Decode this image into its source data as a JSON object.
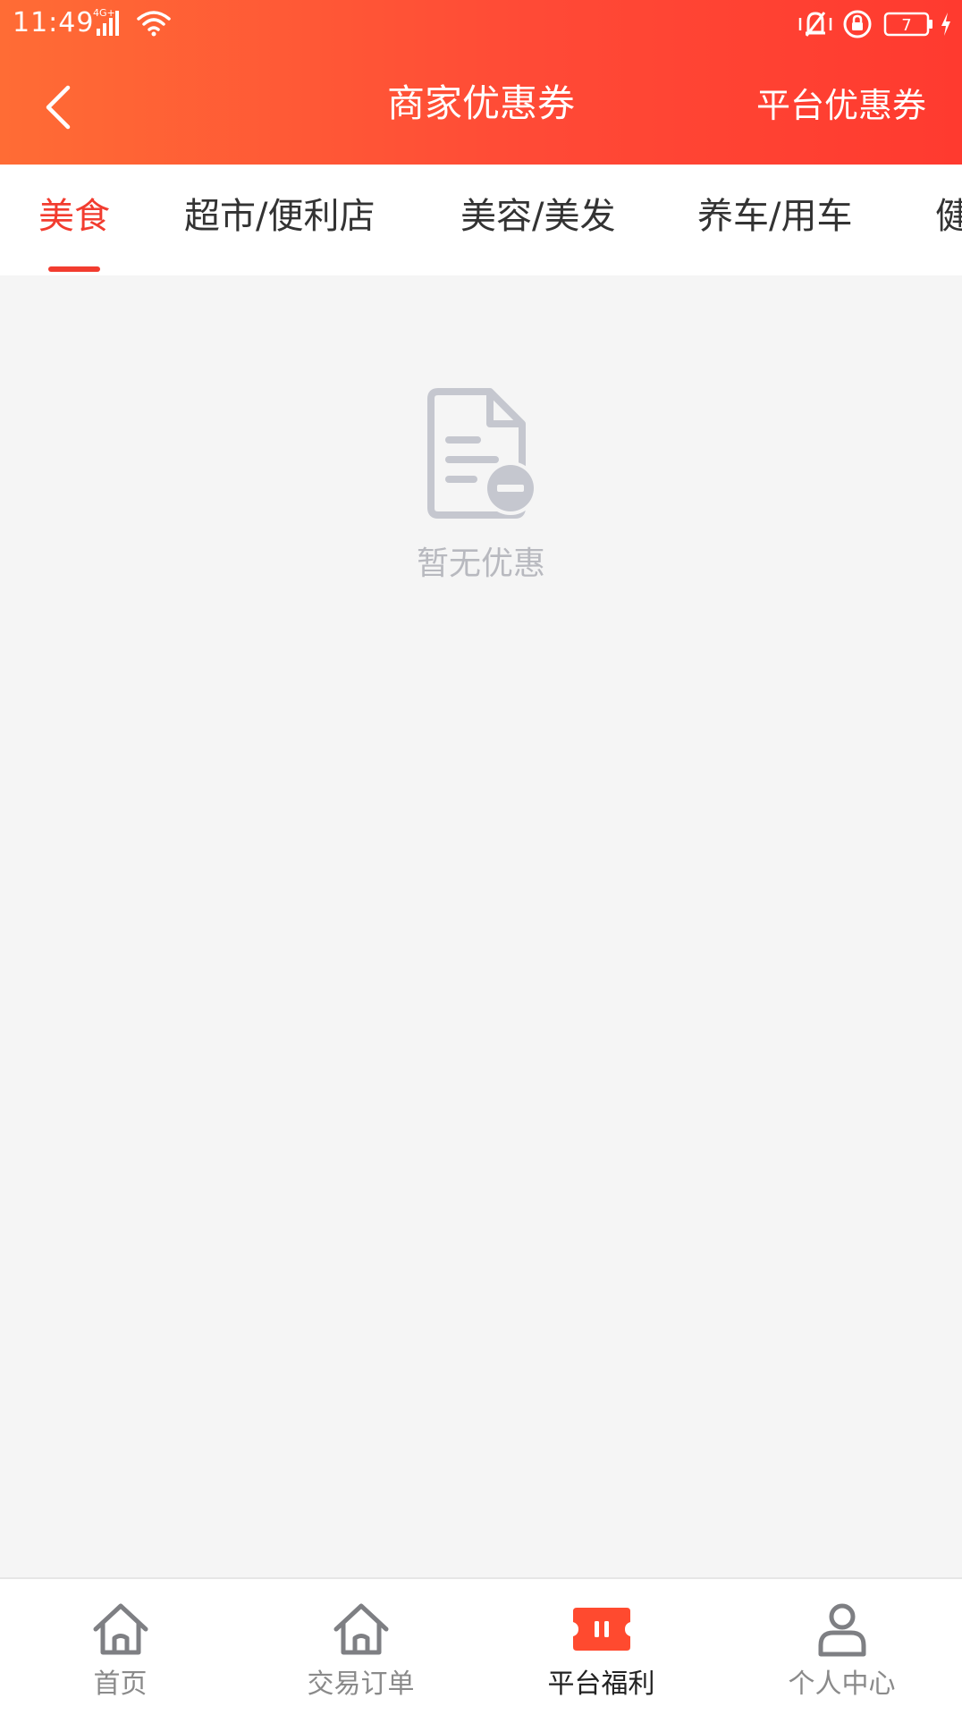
{
  "status_bar": {
    "time": "11:49",
    "network": "4G+",
    "battery": "7",
    "icons": [
      "signal-icon",
      "wifi-icon",
      "vibrate-icon",
      "rotation-lock-icon",
      "battery-icon",
      "charging-icon"
    ]
  },
  "header": {
    "back_icon": "chevron-left-icon",
    "title": "商家优惠券",
    "right_action": "平台优惠券",
    "gradient": [
      "#ff6c35",
      "#ff3a2f"
    ]
  },
  "tabs": {
    "active_index": 0,
    "items": [
      {
        "label": "美食"
      },
      {
        "label": "超市/便利店"
      },
      {
        "label": "美容/美发"
      },
      {
        "label": "养车/用车"
      },
      {
        "label": "健"
      }
    ],
    "active_color": "#f23c2f"
  },
  "empty_state": {
    "icon": "document-minus-icon",
    "text": "暂无优惠"
  },
  "bottom_nav": {
    "active_index": 2,
    "items": [
      {
        "label": "首页",
        "icon": "home-icon"
      },
      {
        "label": "交易订单",
        "icon": "home-icon"
      },
      {
        "label": "平台福利",
        "icon": "ticket-icon"
      },
      {
        "label": "个人中心",
        "icon": "user-icon"
      }
    ]
  }
}
